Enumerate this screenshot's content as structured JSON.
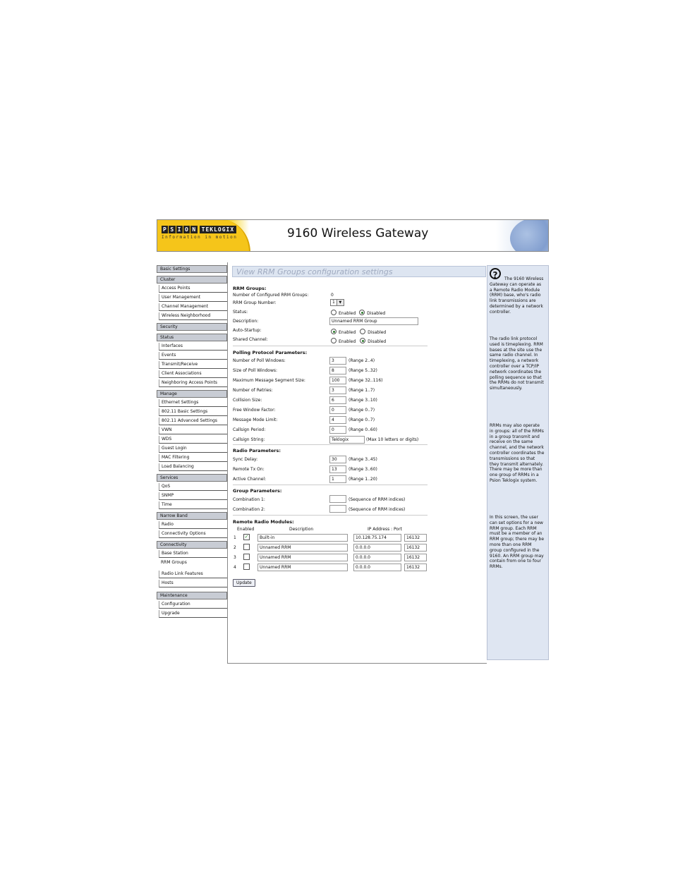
{
  "header": {
    "logo_boxes": [
      "P",
      "S",
      "I",
      "O",
      "N"
    ],
    "logo_brand": "TEKLOGIX",
    "logo_tagline": "Information in motion",
    "title": "9160 Wireless Gateway"
  },
  "sidebar": {
    "sections": [
      {
        "label": "Basic Settings",
        "items": []
      },
      {
        "label": "Cluster",
        "items": [
          "Access Points",
          "User Management",
          "Channel Management",
          "Wireless Neighborhood"
        ]
      },
      {
        "label": "Security",
        "items": []
      },
      {
        "label": "Status",
        "items": [
          "Interfaces",
          "Events",
          "Transmit/Receive",
          "Client Associations",
          "Neighboring Access Points"
        ]
      },
      {
        "label": "Manage",
        "items": [
          "Ethernet Settings",
          "802.11 Basic Settings",
          "802.11 Advanced Settings",
          "VWN",
          "WDS",
          "Guest Login",
          "MAC Filtering",
          "Load Balancing"
        ]
      },
      {
        "label": "Services",
        "items": [
          "QoS",
          "SNMP",
          "Time"
        ]
      },
      {
        "label": "Narrow Band",
        "items": [
          "Radio",
          "Connectivity Options"
        ]
      },
      {
        "label": "Connectivity",
        "items": [
          "Base Station",
          "RRM Groups",
          "Radio Link Features",
          "Hosts"
        ]
      },
      {
        "label": "Maintenance",
        "items": [
          "Configuration",
          "Upgrade"
        ]
      }
    ]
  },
  "main": {
    "page_title": "View RRM Groups configuration settings",
    "rrm_groups": {
      "heading": "RRM Groups:",
      "num_configured_label": "Number of Configured RRM Groups:",
      "num_configured_value": "0",
      "group_number_label": "RRM Group Number:",
      "group_number_value": "1",
      "status_label": "Status:",
      "status_enabled": "Enabled",
      "status_disabled": "Disabled",
      "description_label": "Description:",
      "description_value": "Unnamed RRM Group",
      "auto_startup_label": "Auto-Startup:",
      "auto_enabled": "Enabled",
      "auto_disabled": "Disabled",
      "shared_channel_label": "Shared Channel:",
      "shared_enabled": "Enabled",
      "shared_disabled": "Disabled"
    },
    "polling": {
      "heading": "Polling Protocol Parameters:",
      "rows": [
        {
          "label": "Number of Poll Windows:",
          "value": "3",
          "range": "(Range 2..4)"
        },
        {
          "label": "Size of Poll Windows:",
          "value": "8",
          "range": "(Range 5..32)"
        },
        {
          "label": "Maximum Message Segment Size:",
          "value": "100",
          "range": "(Range 32..116)"
        },
        {
          "label": "Number of Retries:",
          "value": "3",
          "range": "(Range 1..7)"
        },
        {
          "label": "Collision Size:",
          "value": "6",
          "range": "(Range 3..10)"
        },
        {
          "label": "Free Window Factor:",
          "value": "0",
          "range": "(Range 0..7)"
        },
        {
          "label": "Message Mode Limit:",
          "value": "4",
          "range": "(Range 0..7)"
        },
        {
          "label": "Callsign Period:",
          "value": "0",
          "range": "(Range 0..60)"
        }
      ],
      "callsign_label": "Callsign String:",
      "callsign_value": "Teklogix",
      "callsign_range": "(Max 10 letters or digits)"
    },
    "radio": {
      "heading": "Radio Parameters:",
      "rows": [
        {
          "label": "Sync Delay:",
          "value": "30",
          "range": "(Range 3..45)"
        },
        {
          "label": "Remote Tx On:",
          "value": "13",
          "range": "(Range 3..60)"
        },
        {
          "label": "Active Channel:",
          "value": "1",
          "range": "(Range 1..20)"
        }
      ]
    },
    "group": {
      "heading": "Group Parameters:",
      "rows": [
        {
          "label": "Combination 1:",
          "value": "",
          "range": "(Sequence of RRM indices)"
        },
        {
          "label": "Combination 2:",
          "value": "",
          "range": "(Sequence of RRM indices)"
        }
      ]
    },
    "modules": {
      "heading": "Remote Radio Modules:",
      "col_enabled": "Enabled",
      "col_description": "Description",
      "col_ip": "IP Address : Port",
      "rows": [
        {
          "num": "1",
          "checked": true,
          "desc": "Built-in",
          "ip": "10.128.75.174",
          "port": "16132"
        },
        {
          "num": "2",
          "checked": false,
          "desc": "Unnamed RRM",
          "ip": "0.0.0.0",
          "port": "16132"
        },
        {
          "num": "3",
          "checked": false,
          "desc": "Unnamed RRM",
          "ip": "0.0.0.0",
          "port": "16132"
        },
        {
          "num": "4",
          "checked": false,
          "desc": "Unnamed RRM",
          "ip": "0.0.0.0",
          "port": "16132"
        }
      ]
    },
    "update_label": "Update"
  },
  "help": {
    "icon": "question-icon",
    "paragraphs": [
      "The 9160 Wireless Gateway can operate as a Remote Radio Module (RRM) base, who's radio link transmissions are determined by a network controller.",
      "The radio link protocol used is timeplexing. RRM bases at the site use the same radio channel. In timeplexing, a network controller over a TCP/IP network coordinates the polling sequence so that the RRMs do not transmit simultaneously.",
      "RRMs may also operate in groups: all of the RRMs in a group transmit and receive on the same channel, and the network controller coordinates the transmissions so that they transmit alternately. There may be more than one group of RRMs in a Psion Teklogix system.",
      "In this screen, the user can set options for a new RRM group. Each RRM must be a member of an RRM group; there may be more than one RRM group configured in the 9160. An RRM group may contain from one to four RRMs."
    ]
  },
  "colors": {
    "header_yellow": "#f5c51a",
    "help_bg": "#dfe6f2",
    "title_bar_bg": "#dde5f1",
    "nav_head_bg": "#c8ccd4"
  }
}
